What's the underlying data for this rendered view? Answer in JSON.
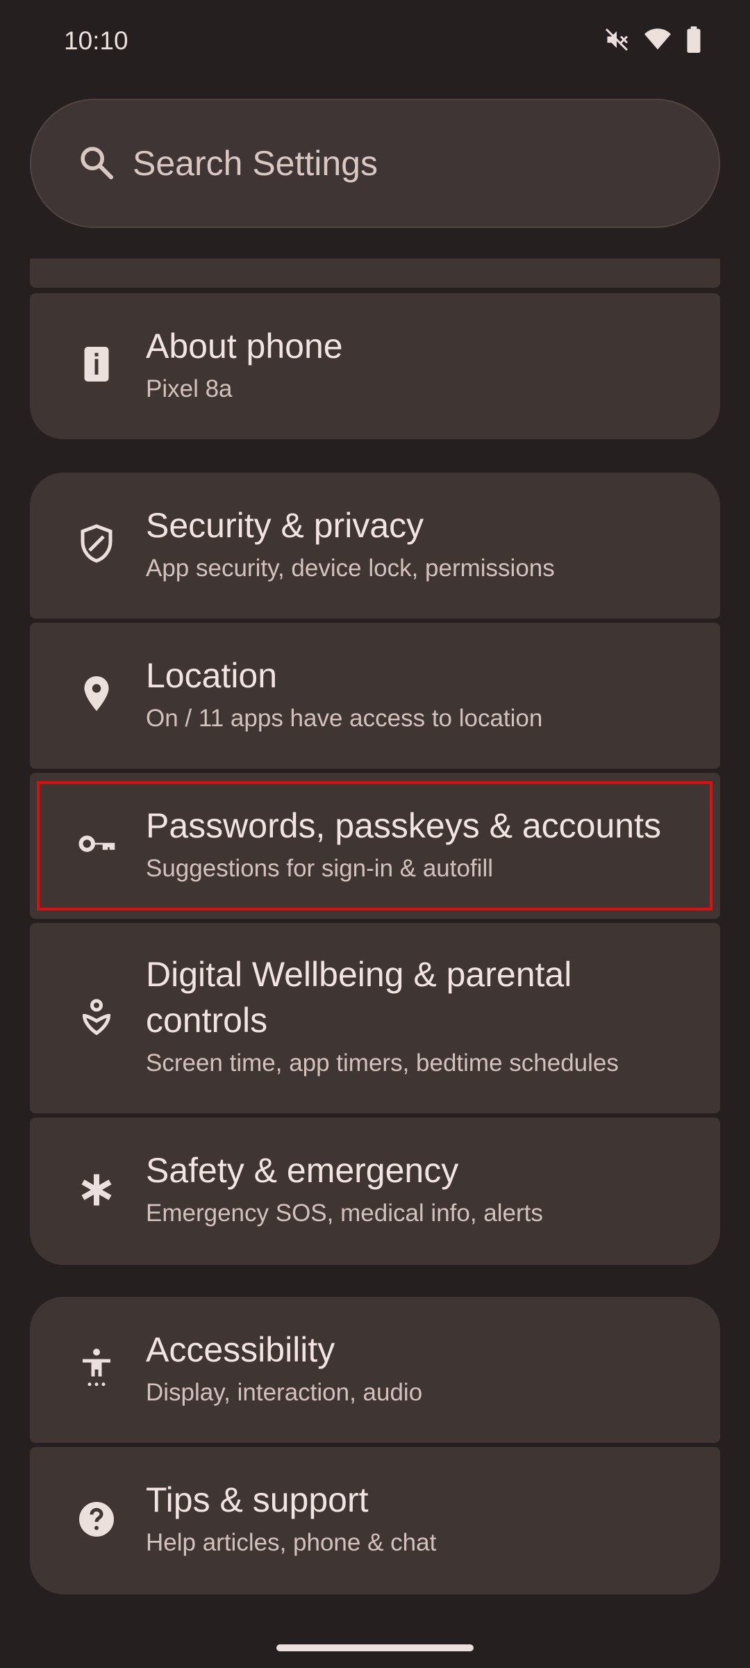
{
  "status_bar": {
    "time": "10:10"
  },
  "search": {
    "placeholder": "Search Settings"
  },
  "settings": [
    {
      "title": "About phone",
      "subtitle": "Pixel 8a",
      "icon": "info-phone-icon"
    },
    {
      "title": "Security & privacy",
      "subtitle": "App security, device lock, permissions",
      "icon": "shield-icon"
    },
    {
      "title": "Location",
      "subtitle": "On / 11 apps have access to location",
      "icon": "location-pin-icon"
    },
    {
      "title": "Passwords, passkeys & accounts",
      "subtitle": "Suggestions for sign-in & autofill",
      "icon": "key-icon"
    },
    {
      "title_line1": "Digital Wellbeing & parental",
      "title_line2": "controls",
      "subtitle": "Screen time, app timers, bedtime schedules",
      "icon": "wellbeing-icon"
    },
    {
      "title": "Safety & emergency",
      "subtitle": "Emergency SOS, medical info, alerts",
      "icon": "asterisk-icon"
    },
    {
      "title": "Accessibility",
      "subtitle": "Display, interaction, audio",
      "icon": "accessibility-icon"
    },
    {
      "title": "Tips & support",
      "subtitle": "Help articles, phone & chat",
      "icon": "help-icon"
    }
  ],
  "colors": {
    "background": "#261f1f",
    "card": "#3f3634",
    "highlight": "#e00d10"
  }
}
